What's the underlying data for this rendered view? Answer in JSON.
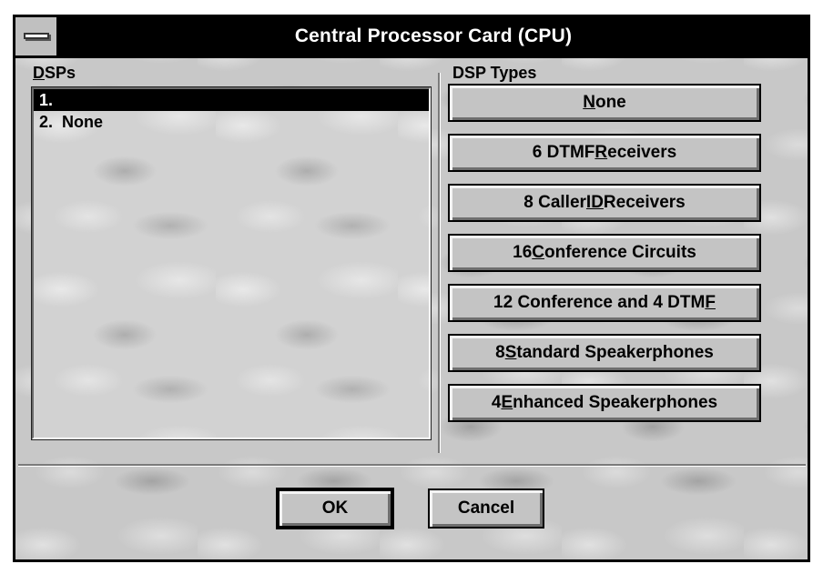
{
  "window": {
    "title": "Central Processor Card (CPU)"
  },
  "dsps": {
    "label_prefix": "",
    "label_accel": "D",
    "label_rest": "SPs",
    "items": [
      {
        "text": "1.",
        "selected": true
      },
      {
        "text": "2.  None",
        "selected": false
      }
    ]
  },
  "dsp_types": {
    "label": "DSP Types",
    "buttons": [
      {
        "pre": "",
        "accel": "N",
        "post": "one"
      },
      {
        "pre": "6 DTMF ",
        "accel": "R",
        "post": "eceivers"
      },
      {
        "pre": "8 Caller ",
        "accel": "ID",
        "post": " Receivers"
      },
      {
        "pre": "16 ",
        "accel": "C",
        "post": "onference Circuits"
      },
      {
        "pre": "12 Conference and 4 DTM",
        "accel": "F",
        "post": ""
      },
      {
        "pre": "8 ",
        "accel": "S",
        "post": "tandard Speakerphones"
      },
      {
        "pre": "4 ",
        "accel": "E",
        "post": "nhanced Speakerphones"
      }
    ]
  },
  "footer": {
    "ok_label": "OK",
    "cancel_label": "Cancel"
  }
}
